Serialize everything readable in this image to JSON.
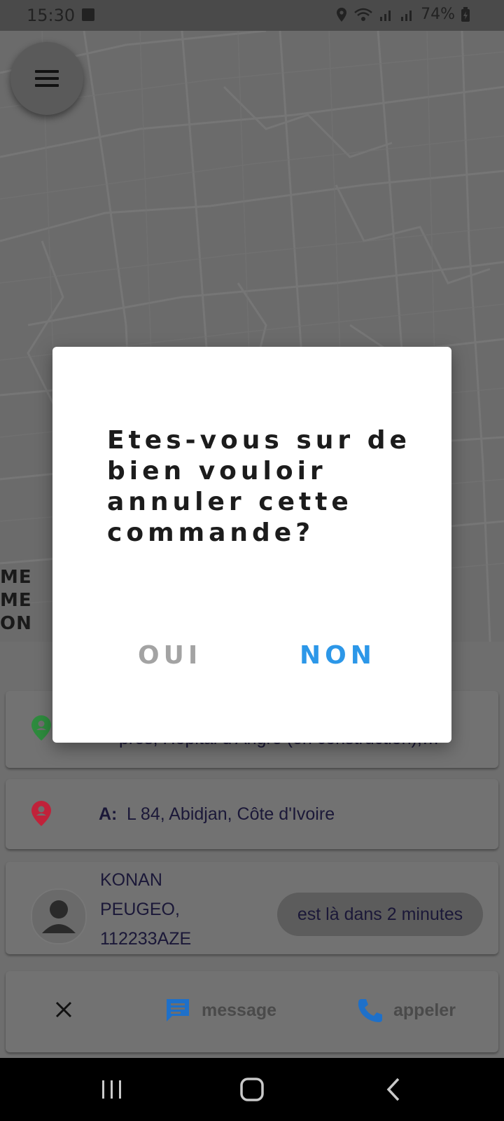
{
  "status_bar": {
    "time": "15:30",
    "battery": "74%",
    "icons": [
      "gallery-icon",
      "location-icon",
      "wifi-icon",
      "signal-icon",
      "battery-charging-icon"
    ]
  },
  "map": {
    "menu_icon": "hamburger-menu-icon",
    "labels": [
      "ME",
      "ME",
      "ON"
    ]
  },
  "trip": {
    "from_text": "pres, Hopital d'Angre (en construction),…",
    "to_prefix": "A:",
    "to_text": "L 84, Abidjan, Côte d'Ivoire",
    "pickup_icon": "pin-green-icon",
    "dropoff_icon": "pin-red-icon"
  },
  "driver": {
    "name": "KONAN",
    "car": "PEUGEO,",
    "plate": "112233AZE",
    "eta": "est là dans 2 minutes",
    "avatar_icon": "person-icon"
  },
  "actions": {
    "cancel_icon": "close-icon",
    "message_label": "message",
    "message_icon": "chat-icon",
    "call_label": "appeler",
    "call_icon": "phone-icon"
  },
  "dialog": {
    "title": "Etes-vous sur de bien vouloir annuler cette commande?",
    "yes_label": "OUI",
    "no_label": "NON"
  },
  "colors": {
    "accent": "#2c97e8",
    "pickup_green": "#2e8b3e",
    "dropoff_red": "#c0223a",
    "overlay": "#6e6e6e"
  }
}
